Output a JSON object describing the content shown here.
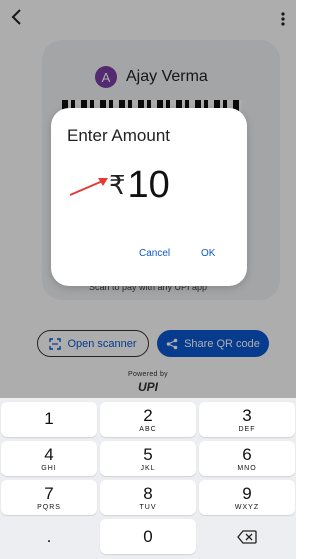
{
  "payee": {
    "initial": "A",
    "name": "Ajay Verma"
  },
  "background": {
    "scan_hint": "Scan to pay with any UPI app",
    "open_scanner_label": "Open scanner",
    "share_qr_label": "Share QR code",
    "powered_by": "Powered by",
    "upi_logo_text": "UPI"
  },
  "dialog": {
    "title": "Enter Amount",
    "currency_symbol": "₹",
    "amount": "10",
    "cancel_label": "Cancel",
    "ok_label": "OK"
  },
  "keypad": {
    "keys": [
      {
        "digit": "1",
        "letters": ""
      },
      {
        "digit": "2",
        "letters": "ABC"
      },
      {
        "digit": "3",
        "letters": "DEF"
      },
      {
        "digit": "4",
        "letters": "GHI"
      },
      {
        "digit": "5",
        "letters": "JKL"
      },
      {
        "digit": "6",
        "letters": "MNO"
      },
      {
        "digit": "7",
        "letters": "PQRS"
      },
      {
        "digit": "8",
        "letters": "TUV"
      },
      {
        "digit": "9",
        "letters": "WXYZ"
      }
    ],
    "dot": ".",
    "zero": "0"
  },
  "colors": {
    "accent": "#0b57d0",
    "avatar": "#7b3ea6",
    "annotation_arrow": "#e53935"
  }
}
